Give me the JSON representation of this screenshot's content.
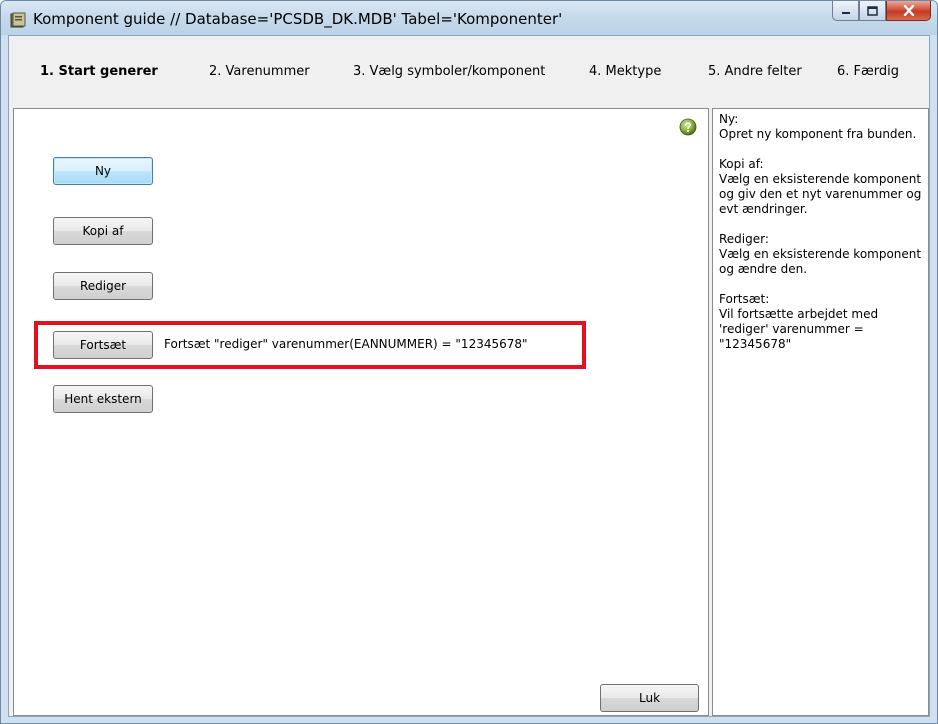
{
  "window": {
    "title": "Komponent guide  //  Database='PCSDB_DK.MDB' Tabel='Komponenter'",
    "icon": "app-book-icon"
  },
  "caption_buttons": {
    "minimize_icon": "minimize-icon",
    "maximize_icon": "maximize-icon",
    "close_icon": "close-icon"
  },
  "tabs": [
    {
      "label": "1. Start generer",
      "active": true
    },
    {
      "label": "2. Varenummer",
      "active": false
    },
    {
      "label": "3. Vælg symboler/komponent",
      "active": false
    },
    {
      "label": "4. Mektype",
      "active": false
    },
    {
      "label": "5. Andre felter",
      "active": false
    },
    {
      "label": "6. Færdig",
      "active": false
    }
  ],
  "main": {
    "buttons": {
      "new_label": "Ny",
      "copy_label": "Kopi af",
      "edit_label": "Rediger",
      "continue_label": "Fortsæt",
      "fetch_external_label": "Hent ekstern",
      "close_label": "Luk"
    },
    "continue_text": "Fortsæt \"rediger\" varenummer(EANNUMMER) = \"12345678\"",
    "help_icon": "question-mark-icon",
    "highlight_color": "#e4101c"
  },
  "help": [
    {
      "heading": "Ny:",
      "text": "Opret ny komponent fra bunden."
    },
    {
      "heading": "Kopi af:",
      "text": "Vælg en eksisterende komponent og giv den et nyt varenummer og evt ændringer."
    },
    {
      "heading": "Rediger:",
      "text": "Vælg en eksisterende komponent og ændre den."
    },
    {
      "heading": "Fortsæt:",
      "text": "Vil fortsætte arbejdet med 'rediger' varenummer = \"12345678\""
    }
  ]
}
